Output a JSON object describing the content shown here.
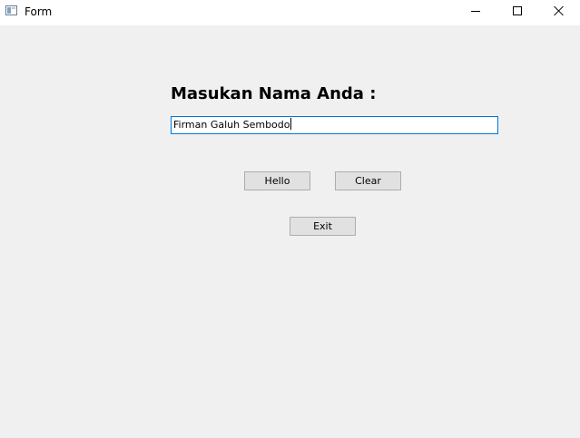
{
  "window": {
    "title": "Form"
  },
  "form": {
    "prompt_label": "Masukan Nama Anda :",
    "name_value": "Firman Galuh Sembodo",
    "hello_label": "Hello",
    "clear_label": "Clear",
    "exit_label": "Exit"
  },
  "icons": {
    "app": "form-window-icon",
    "minimize": "minimize-icon",
    "maximize": "maximize-icon",
    "close": "close-icon"
  },
  "colors": {
    "background": "#f0f0f0",
    "focus_border": "#0078d7",
    "button_face": "#e1e1e1"
  }
}
